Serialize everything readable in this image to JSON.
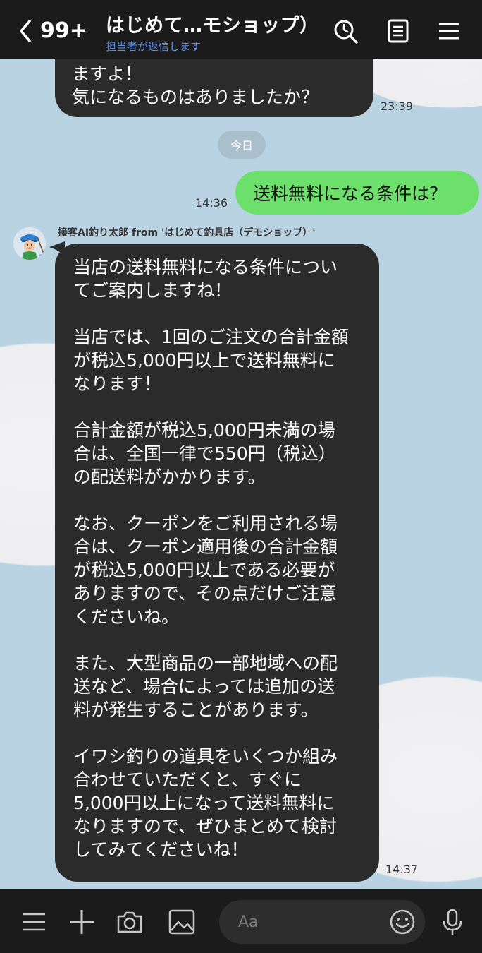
{
  "header": {
    "back_label": "99+",
    "title": "はじめて…モショップ）",
    "subtitle": "担当者が返信します",
    "icons": [
      "chevron-left-icon",
      "search-icon",
      "notes-icon",
      "menu-icon"
    ]
  },
  "messages": {
    "prev_bot": {
      "lines": [
        "ますよ！",
        "気になるものはありましたか？"
      ],
      "time": "23:39"
    },
    "date_divider": "今日",
    "user": {
      "text": "送料無料になる条件は？",
      "time": "14:36"
    },
    "bot": {
      "sender": "接客AI釣り太郎 from 'はじめて釣具店（デモショップ）'",
      "lines": [
        "当店の送料無料になる条件につい",
        "てご案内しますね！",
        "",
        "当店では、1回のご注文の合計金額",
        "が税込5,000円以上で送料無料に",
        "なります！",
        "",
        "合計金額が税込5,000円未満の場",
        "合は、全国一律で550円（税込）",
        "の配送料がかかります。",
        "",
        "なお、クーポンをご利用される場",
        "合は、クーポン適用後の合計金額",
        "が税込5,000円以上である必要が",
        "ありますので、その点だけご注意",
        "くださいね。",
        "",
        "また、大型商品の一部地域への配",
        "送など、場合によっては追加の送",
        "料が発生することがあります。",
        "",
        "イワシ釣りの道具をいくつか組み",
        "合わせていただくと、すぐに",
        "5,000円以上になって送料無料に",
        "なりますので、ぜひまとめて検討",
        "してみてくださいね！"
      ],
      "time": "14:37"
    }
  },
  "footer": {
    "input_placeholder": "Aa",
    "icons": [
      "menu-icon",
      "plus-icon",
      "camera-icon",
      "image-icon",
      "emoji-icon",
      "mic-icon"
    ]
  },
  "colors": {
    "header_bg": "#1b1b1b",
    "chat_bg": "#b9d3e3",
    "bot_bubble": "#2b2b2b",
    "user_bubble": "#6de06b",
    "subtitle": "#5b8fe8"
  }
}
